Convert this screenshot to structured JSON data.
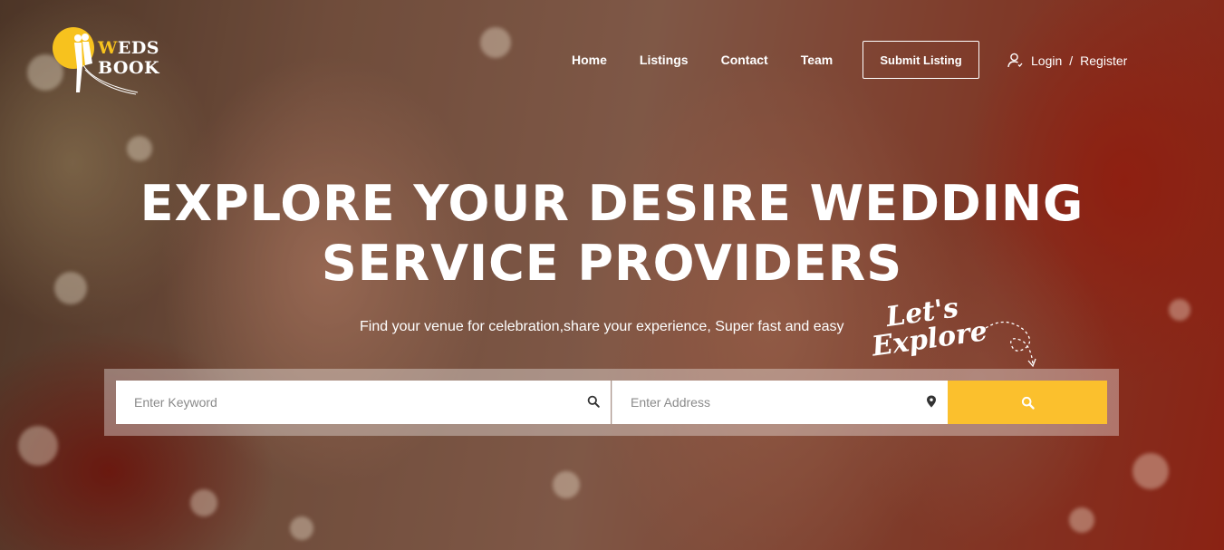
{
  "brand": {
    "name_first_letter": "W",
    "name_rest": "EDS BOOK",
    "accent_color": "#f7c21e"
  },
  "nav": {
    "items": [
      {
        "label": "Home"
      },
      {
        "label": "Listings"
      },
      {
        "label": "Contact"
      },
      {
        "label": "Team"
      }
    ],
    "submit_label": "Submit Listing",
    "login_label": "Login",
    "separator": "/",
    "register_label": "Register",
    "user_icon": "user-icon"
  },
  "hero": {
    "headline_line1": "EXPLORE YOUR DESIRE WEDDING",
    "headline_line2": "SERVICE PROVIDERS",
    "subtitle": "Find your venue for celebration,share your experience, Super fast and easy",
    "lets_line1": "Let's",
    "lets_line2": "Explore"
  },
  "search": {
    "keyword_placeholder": "Enter Keyword",
    "keyword_value": "",
    "keyword_icon": "search-icon",
    "address_placeholder": "Enter Address",
    "address_value": "",
    "address_icon": "map-marker-icon",
    "button_icon": "search-icon",
    "button_color": "#fbc02d"
  }
}
